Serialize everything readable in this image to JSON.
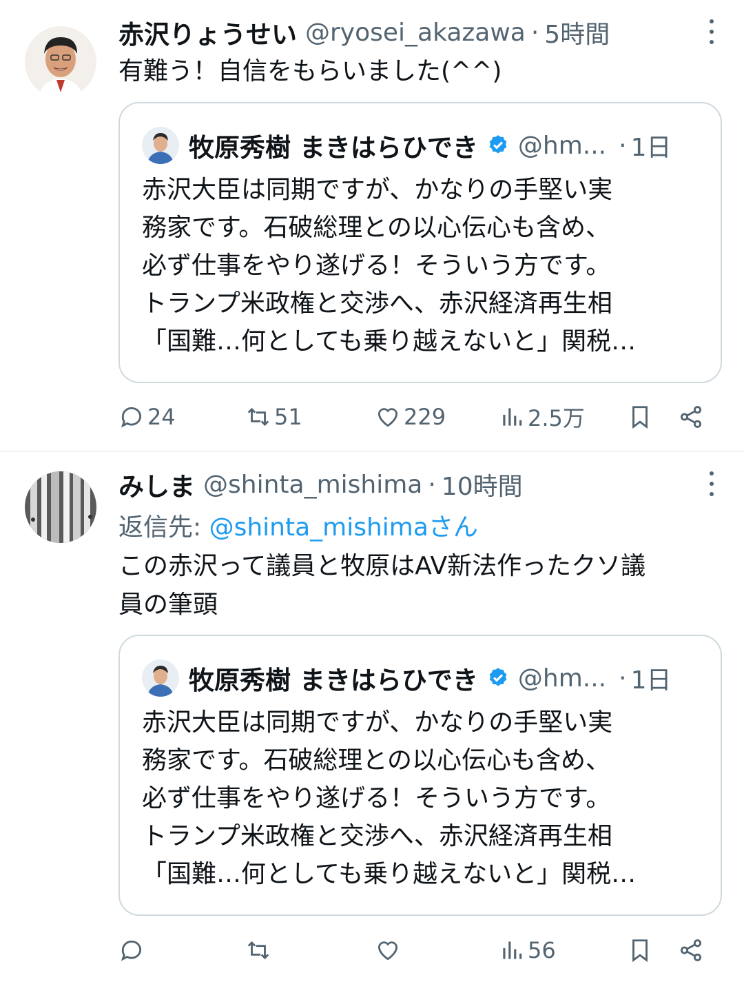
{
  "tweets": [
    {
      "author": {
        "name": "赤沢りょうせい",
        "handle": "@ryosei_akazawa",
        "time": "5時間"
      },
      "separator": "·",
      "text": "有難う！自信をもらいました(^^)",
      "quote": {
        "name": "牧原秀樹 まきはらひでき",
        "handle": "@hm...",
        "time": "1日",
        "separator": "·",
        "lines": [
          "赤沢大臣は同期ですが、かなりの手堅い実",
          "務家です。石破総理との以心伝心も含め、",
          "必ず仕事をやり遂げる！そういう方です。",
          "トランプ米政権と交渉へ、赤沢経済再生相",
          "「国難…何としても乗り越えないと」関税…"
        ]
      },
      "actions": {
        "reply": "24",
        "retweet": "51",
        "like": "229",
        "views": "2.5万"
      }
    },
    {
      "author": {
        "name": "みしま",
        "handle": "@shinta_mishima",
        "time": "10時間"
      },
      "separator": "·",
      "reply_prefix": "返信先: ",
      "reply_to": "@shinta_mishimaさん",
      "text_lines": [
        "この赤沢って議員と牧原はAV新法作ったクソ議",
        "員の筆頭"
      ],
      "quote": {
        "name": "牧原秀樹 まきはらひでき",
        "handle": "@hm...",
        "time": "1日",
        "separator": "·",
        "lines": [
          "赤沢大臣は同期ですが、かなりの手堅い実",
          "務家です。石破総理との以心伝心も含め、",
          "必ず仕事をやり遂げる！そういう方です。",
          "トランプ米政権と交渉へ、赤沢経済再生相",
          "「国難…何としても乗り越えないと」関税…"
        ]
      },
      "actions": {
        "reply": "",
        "retweet": "",
        "like": "",
        "views": "56"
      }
    }
  ],
  "colors": {
    "text": "#0f1419",
    "secondary": "#536471",
    "link": "#1d9bf0",
    "border": "#cfd9de",
    "verified": "#1d9bf0"
  },
  "icons": [
    "more-vertical-icon",
    "verified-badge-icon",
    "reply-icon",
    "retweet-icon",
    "like-icon",
    "views-icon",
    "bookmark-icon",
    "share-icon"
  ]
}
